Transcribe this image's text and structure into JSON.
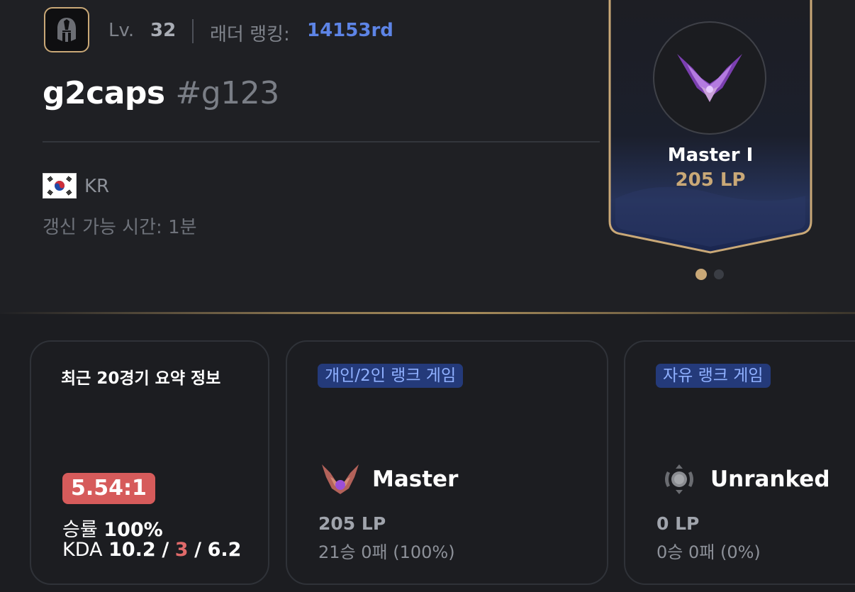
{
  "profile": {
    "level_label": "Lv.",
    "level": "32",
    "ladder_label": "래더 랭킹:",
    "ladder_rank": "14153rd",
    "name": "g2caps",
    "tag": "#g123",
    "region": "KR",
    "refresh_text": "갱신 가능 시간: 1분",
    "avatar_icon": "spartan-helmet-icon",
    "flag_icon": "korea-flag-icon"
  },
  "rank_card": {
    "tier": "Master I",
    "lp": "205 LP",
    "emblem_icon": "master-emblem-icon",
    "carousel_pages": 2,
    "active_page": 1
  },
  "summary": {
    "title": "최근 20경기 요약 정보",
    "kda_ratio": "5.54:1",
    "winrate_label": "승률",
    "winrate": "100%",
    "kda_label": "KDA",
    "kills": "10.2",
    "deaths": "3",
    "assists": "6.2",
    "slash": "/"
  },
  "solo_queue": {
    "badge": "개인/2인 랭크 게임",
    "tier": "Master",
    "lp": "205 LP",
    "record": "21승 0패 (100%)",
    "icon": "master-emblem-icon"
  },
  "flex_queue": {
    "badge": "자유 랭크 게임",
    "tier": "Unranked",
    "lp": "0 LP",
    "record": "0승 0패 (0%)",
    "icon": "unranked-emblem-icon"
  },
  "colors": {
    "background": "#1f2024",
    "gold": "#c9a877",
    "ladder_blue": "#5d84e6",
    "kda_red": "#d65b5b",
    "badge_bg": "#243a7a"
  }
}
